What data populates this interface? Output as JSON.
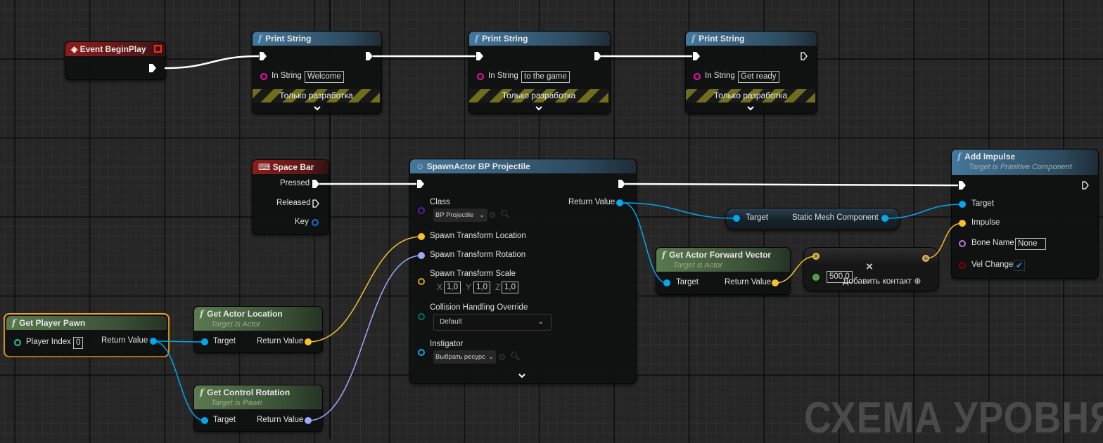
{
  "graph": {
    "watermark": "СХЕМА УРОВНЯ"
  },
  "colors": {
    "exec": "#ffffff",
    "object": "#00a8f0",
    "vector": "#f5c22a",
    "rotator": "#9fa8ff",
    "string": "#f010b0",
    "class": "#5a1ca8",
    "enum": "#006e6e",
    "name": "#b07adf",
    "bool": "#8c0000",
    "float": "#34c520",
    "selection": "#f0a020"
  },
  "begin_play": {
    "title": "Event BeginPlay"
  },
  "print1": {
    "title": "Print String",
    "in_label": "In String",
    "in_value": "Welcome",
    "dev": "Только разработка"
  },
  "print2": {
    "title": "Print String",
    "in_label": "In String",
    "in_value": "to the game",
    "dev": "Только разработка"
  },
  "print3": {
    "title": "Print String",
    "in_label": "In String",
    "in_value": "Get ready",
    "dev": "Только разработка"
  },
  "space_bar": {
    "title": "Space Bar",
    "pressed": "Pressed",
    "released": "Released",
    "key": "Key"
  },
  "spawn": {
    "title": "SpawnActor BP Projectile",
    "class_label": "Class",
    "class_value": "BP Projectile",
    "return_label": "Return Value",
    "loc": "Spawn Transform Location",
    "rot": "Spawn Transform Rotation",
    "scale": "Spawn Transform Scale",
    "x": "X",
    "y": "Y",
    "z": "Z",
    "sx": "1,0",
    "sy": "1,0",
    "sz": "1,0",
    "collision_label": "Collision Handling Override",
    "collision_value": "Default",
    "instigator_label": "Instigator",
    "instigator_value": "Выбрать ресурс"
  },
  "static_mesh": {
    "target": "Target",
    "out": "Static Mesh Component"
  },
  "forward": {
    "title": "Get Actor Forward Vector",
    "subtitle": "Target is Actor",
    "target": "Target",
    "ret": "Return Value"
  },
  "multiply": {
    "symbol": "×",
    "value": "500,0",
    "add_pin": "Добавить контакт"
  },
  "impulse": {
    "title": "Add Impulse",
    "subtitle": "Target is Primitive Component",
    "target": "Target",
    "impulse": "Impulse",
    "bone_label": "Bone Name",
    "bone_value": "None",
    "vel_label": "Vel Change",
    "vel_checked": true
  },
  "pawn": {
    "title": "Get Player Pawn",
    "index_label": "Player Index",
    "index_value": "0",
    "ret": "Return Value"
  },
  "location": {
    "title": "Get Actor Location",
    "subtitle": "Target is Actor",
    "target": "Target",
    "ret": "Return Value"
  },
  "rotation": {
    "title": "Get Control Rotation",
    "subtitle": "Target is Pawn",
    "target": "Target",
    "ret": "Return Value"
  }
}
